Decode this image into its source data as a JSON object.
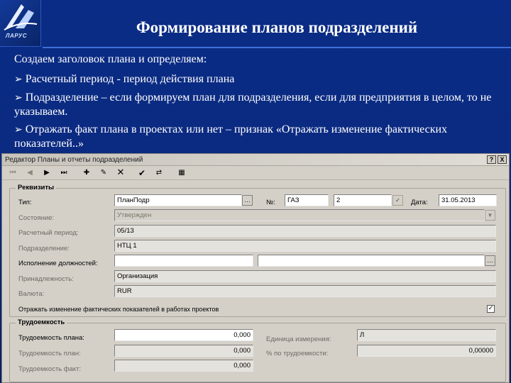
{
  "slide": {
    "logo_text": "ЛАРУС",
    "title": "Формирование планов подразделений",
    "intro": "Создаем заголовок плана и определяем:",
    "bullets": [
      "Расчетный период - период действия плана",
      "Подразделение – если формируем план для подразделения, если для предприятия в целом, то не указываем.",
      "Отражать факт плана в проектах или нет – признак «Отражать изменение фактических показателей..»"
    ]
  },
  "window": {
    "title": "Редактор   Планы и отчеты подразделений",
    "help_label": "?",
    "close_label": "X",
    "toolbar_icons": [
      "first-icon",
      "prev-icon",
      "next-icon",
      "last-icon",
      "add-icon",
      "edit-icon",
      "delete-icon",
      "confirm-icon",
      "refresh-icon",
      "grid-icon"
    ]
  },
  "requisites": {
    "group_title": "Реквизиты",
    "type_label": "Тип:",
    "type_value": "ПланПодр",
    "number_label": "№:",
    "number_prefix": "ГАЗ",
    "number_value": "2",
    "date_label": "Дата:",
    "date_value": "31.05.2013",
    "state_label": "Состояние:",
    "state_value": "Утвержден",
    "period_label": "Расчетный период:",
    "period_value": "05/13",
    "division_label": "Подразделение:",
    "division_value": "НТЦ 1",
    "duty_label": "Исполнение должностей:",
    "duty_value_left": "",
    "duty_value_right": "",
    "belonging_label": "Принадлежность:",
    "belonging_value": "Организация",
    "currency_label": "Валюта:",
    "currency_value": "RUR",
    "reflect_label": "Отражать изменение фактических показателей в работах проектов",
    "reflect_checked": "✓"
  },
  "labor": {
    "group_title": "Трудоемкость",
    "plan_label": "Трудоемкость плана:",
    "plan_value": "0,000",
    "planned_label": "Трудоемкость план:",
    "planned_value": "0,000",
    "fact_label": "Трудоемкость факт:",
    "fact_value": "0,000",
    "unit_label": "Единица измерения:",
    "unit_value": "Л",
    "percent_label": "% по трудоемкости:",
    "percent_value": "0,00000"
  }
}
